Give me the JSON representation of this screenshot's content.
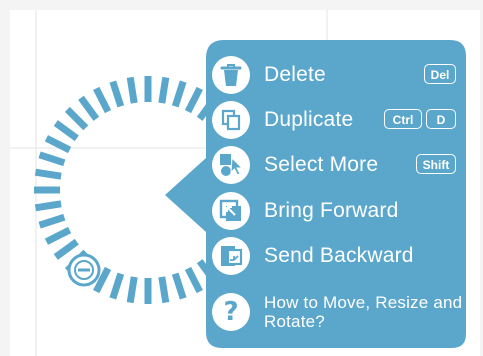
{
  "colors": {
    "menu_background": "#5ba7cc",
    "handle_segments": "#5ba7cc",
    "canvas_background": "#ffffff",
    "grid_lines": "#e6e6e6"
  },
  "menu": {
    "items": [
      {
        "id": "delete",
        "label": "Delete",
        "icon": "trash-icon",
        "shortcut": [
          "Del"
        ]
      },
      {
        "id": "duplicate",
        "label": "Duplicate",
        "icon": "duplicate-icon",
        "shortcut": [
          "Ctrl",
          "D"
        ]
      },
      {
        "id": "select-more",
        "label": "Select More",
        "icon": "select-more-icon",
        "shortcut": [
          "Shift"
        ]
      },
      {
        "id": "bring-forward",
        "label": "Bring Forward",
        "icon": "bring-forward-icon",
        "shortcut": []
      },
      {
        "id": "send-backward",
        "label": "Send Backward",
        "icon": "send-backward-icon",
        "shortcut": []
      },
      {
        "id": "help",
        "label": "How to Move, Resize and Rotate?",
        "icon": "question-icon",
        "shortcut": []
      }
    ]
  },
  "rotate_handle": {
    "icon": "minus-circle-icon"
  }
}
